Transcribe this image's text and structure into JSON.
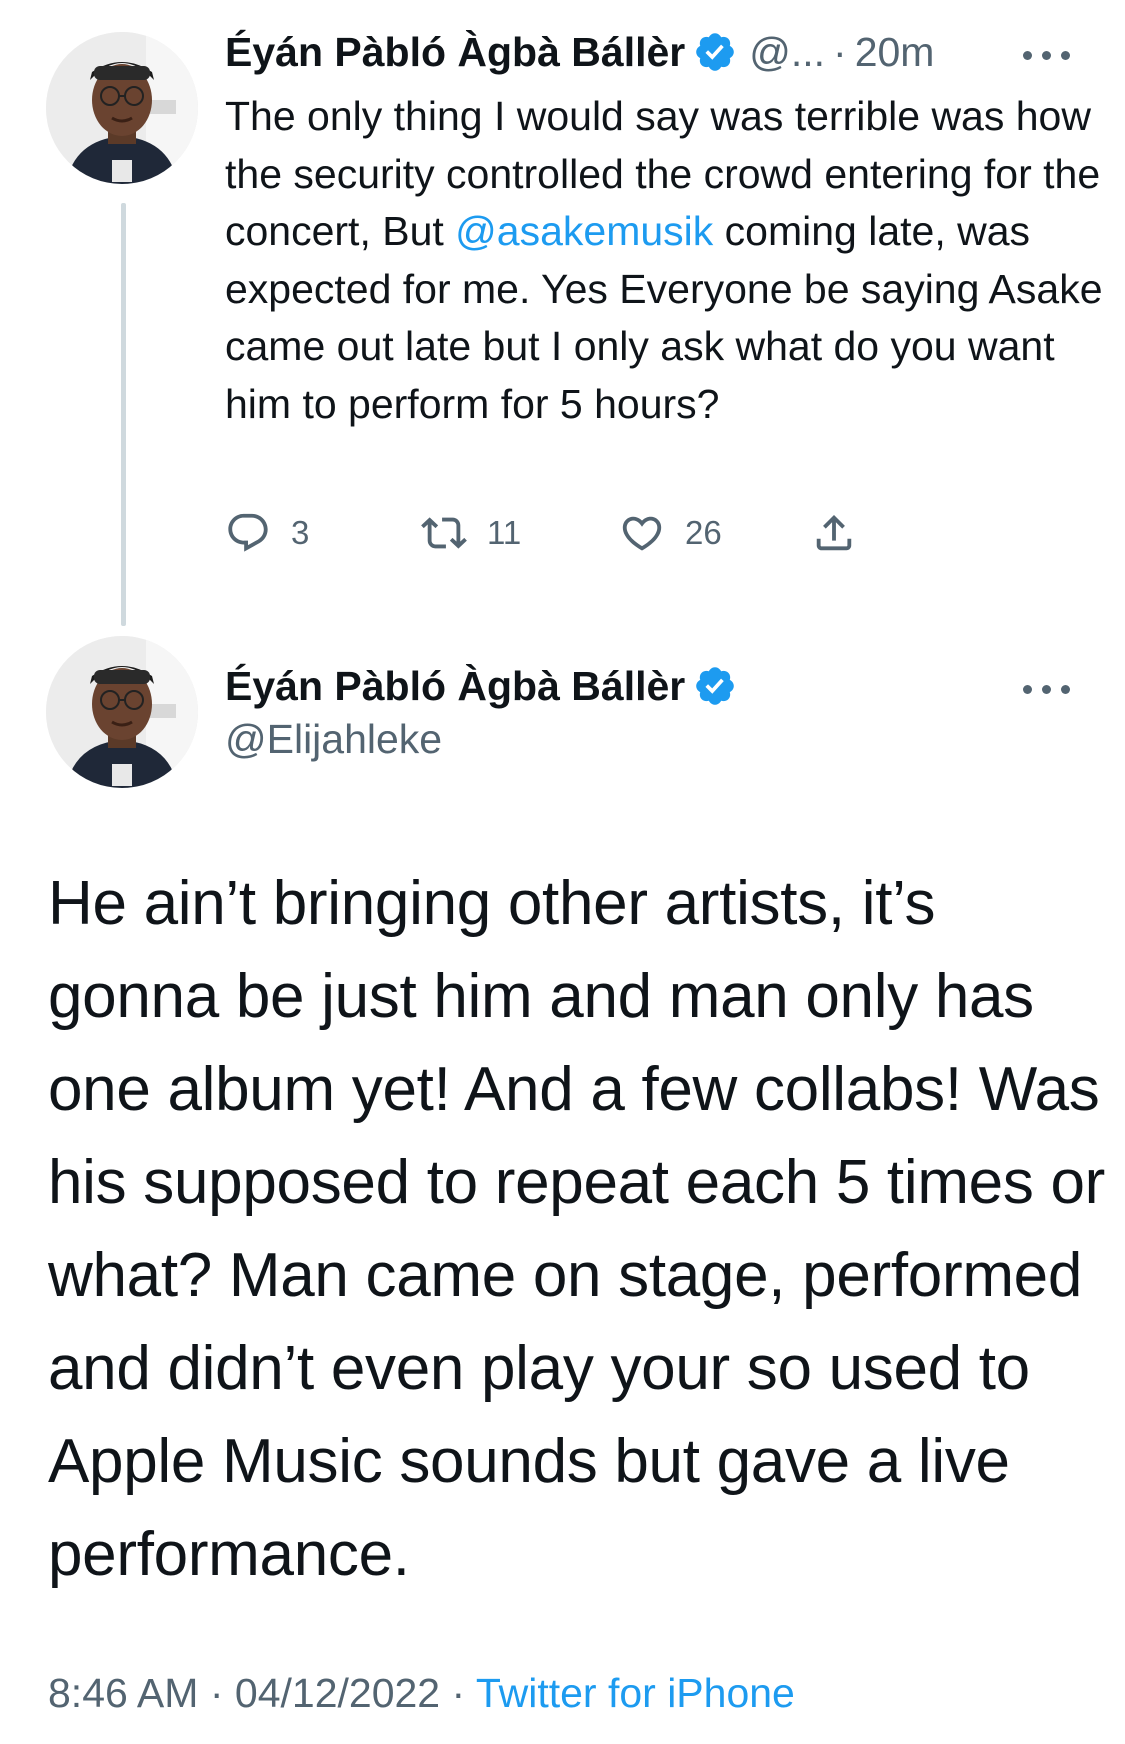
{
  "reply_tweet": {
    "display_name": "Éyán Pàbló Àgbà Bállèr",
    "handle_truncated": "@...",
    "separator": "·",
    "time_ago": "20m",
    "text_before_mention": "The only thing I would say was terrible was how the security controlled the crowd entering for the concert, But ",
    "mention": "@asakemusik",
    "text_after_mention": " coming late, was expected for me. Yes Everyone be saying Asake came out late but I only ask what do you want him to perform for 5 hours?",
    "replies_count": "3",
    "retweets_count": "11",
    "likes_count": "26"
  },
  "main_tweet": {
    "display_name": "Éyán Pàbló Àgbà Bállèr",
    "handle": "@Elijahleke",
    "text": "He ain’t bringing other artists, it’s gonna be just him and man only has one album yet! And a few collabs! Was his supposed to repeat each 5 times or what? Man came on stage, performed and didn’t even play your so used to Apple Music sounds but gave a live performance.",
    "time": "8:46 AM",
    "separator": "·",
    "date": "04/12/2022",
    "source": "Twitter for iPhone"
  },
  "icons": {
    "verified": "verified-badge-icon",
    "more": "more-options-icon",
    "reply": "reply-icon",
    "retweet": "retweet-icon",
    "like": "heart-icon",
    "share": "share-icon"
  },
  "colors": {
    "text": "#0f1419",
    "muted": "#536471",
    "accent": "#1d9bf0",
    "thread_line": "#cfd9de"
  }
}
